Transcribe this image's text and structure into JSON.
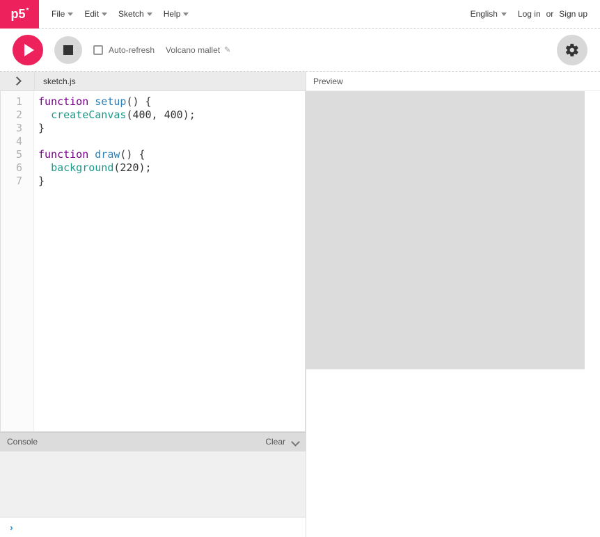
{
  "logo": "p5",
  "menu": {
    "file": "File",
    "edit": "Edit",
    "sketch": "Sketch",
    "help": "Help"
  },
  "header_right": {
    "language": "English",
    "login": "Log in",
    "or": "or",
    "signup": "Sign up"
  },
  "toolbar": {
    "autorefresh_label": "Auto-refresh",
    "sketch_name": "Volcano mallet"
  },
  "editor": {
    "current_file": "sketch.js",
    "lines": [
      "1",
      "2",
      "3",
      "4",
      "5",
      "6",
      "7"
    ],
    "code": {
      "l1_kw": "function",
      "l1_fn": "setup",
      "l1_rest": "() {",
      "l2_bi": "createCanvas",
      "l2_rest": "(400, 400);",
      "l3": "}",
      "l5_kw": "function",
      "l5_fn": "draw",
      "l5_rest": "() {",
      "l6_bi": "background",
      "l6_rest": "(220);",
      "l7": "}"
    }
  },
  "console": {
    "title": "Console",
    "clear": "Clear"
  },
  "preview": {
    "title": "Preview"
  }
}
